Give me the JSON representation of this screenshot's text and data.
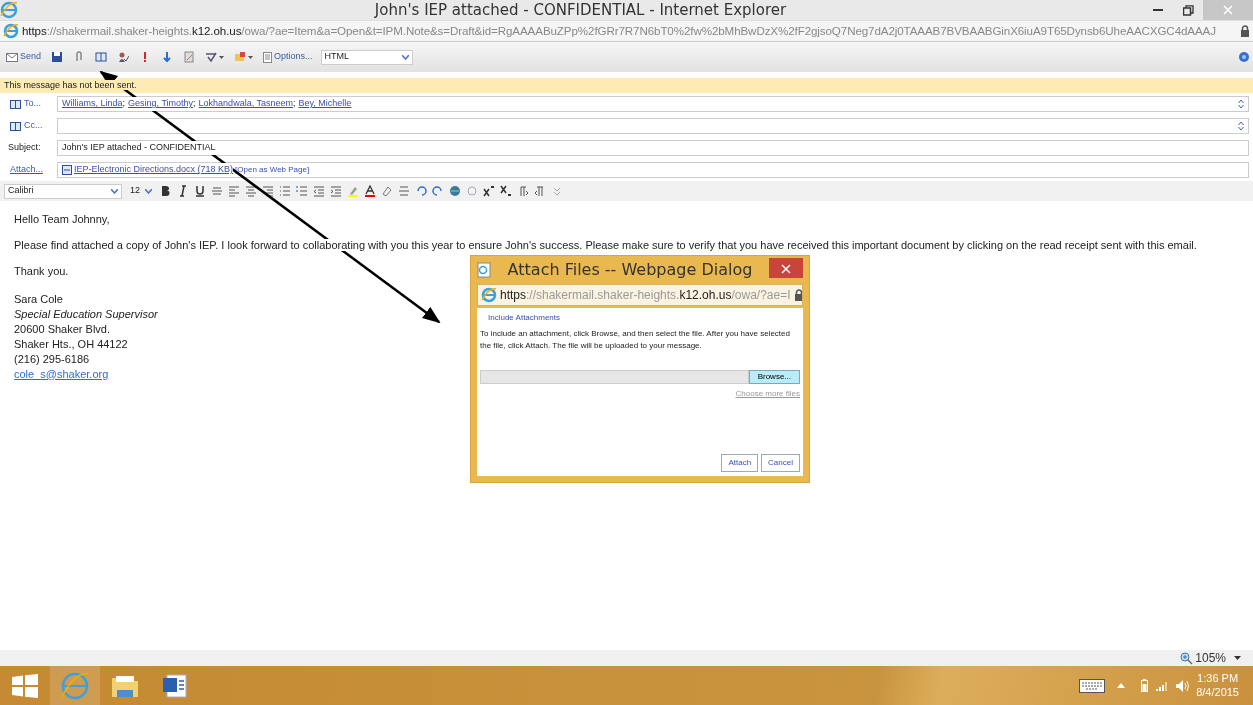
{
  "window": {
    "title": "John's IEP attached - CONFIDENTIAL - Internet Explorer"
  },
  "address": {
    "scheme": "https",
    "mid": "://shakermail.shaker-heights.",
    "domain": "k12.oh.us",
    "path": "/owa/?ae=Item&a=Open&t=IPM.Note&s=Draft&id=RgAAAABuZPp%2fGRr7R7N6bT0%2fw%2bMhBwDzX%2fF2gjsoQ7Neg7dA2j0TAAAB7BVBAABGinX6iuA9T65Dynsb6UheAACXGC4dAAAJ"
  },
  "toolbar": {
    "send": "Send",
    "options": "Options...",
    "format": "HTML"
  },
  "notice": "This message has not been sent.",
  "to": {
    "label": "To...",
    "recipients": [
      "Williams, Linda",
      "Gesing, Timothy",
      "Lokhandwala, Tasneem",
      "Bey, Michelle"
    ],
    "separator": ";"
  },
  "cc": {
    "label": "Cc..."
  },
  "subject": {
    "label": "Subject:",
    "value": "John's IEP attached - CONFIDENTIAL"
  },
  "attach": {
    "label": "Attach...",
    "file": "IEP-Electronic Directions.docx (718 KB)",
    "open_link": "[Open as Web Page]"
  },
  "format_bar": {
    "font": "Calibri",
    "size": "12"
  },
  "body": {
    "greeting": "Hello Team Johnny,",
    "paragraph": "Please find attached a copy of John's IEP. I look forward to collaborating with you this year to ensure John's success. Please make sure to verify that you have received this important document by clicking on the read receipt sent with this email.",
    "closing": "Thank you.",
    "signature": [
      {
        "text": "Sara Cole",
        "kind": "plain"
      },
      {
        "text": "Special Education Supervisor",
        "kind": "italic"
      },
      {
        "text": "20600 Shaker Blvd.",
        "kind": "plain"
      },
      {
        "text": "Shaker Hts., OH 44122",
        "kind": "plain"
      },
      {
        "text": "(216) 295-6186",
        "kind": "plain"
      },
      {
        "text": "cole_s@shaker.org",
        "kind": "link"
      }
    ]
  },
  "dialog": {
    "title": "Attach Files -- Webpage Dialog",
    "address": {
      "scheme": "https",
      "mid": "://shakermail.shaker-heights.",
      "domain": "k12.oh.us",
      "path": "/owa/?ae=I"
    },
    "section": "Include Attachments",
    "instructions": "To include an attachment, click Browse, and then select the file. After you have selected the file, click Attach. The file will be uploaded to your message.",
    "browse": "Browse...",
    "more_files": "Choose more files",
    "attach": "Attach",
    "cancel": "Cancel"
  },
  "status_bar": {
    "zoom": "105%"
  },
  "taskbar": {
    "time": "1:36 PM",
    "date": "8/4/2015"
  }
}
